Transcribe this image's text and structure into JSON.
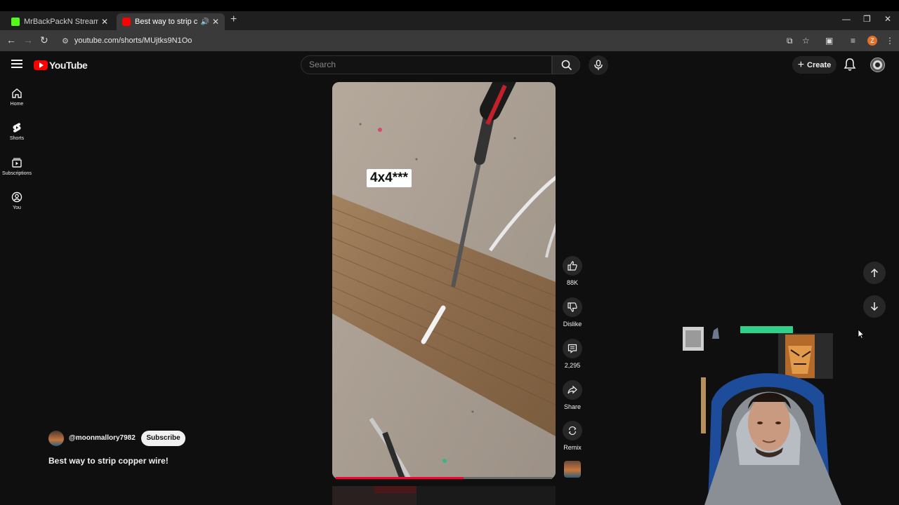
{
  "browser": {
    "tabs": [
      {
        "label": "MrBackPackN Stream - Watch Live",
        "favicon_color": "#53fc18"
      },
      {
        "label": "Best way to strip copper wire!",
        "favicon_color": "#ff0000"
      }
    ],
    "url": "youtube.com/shorts/MUjtks9N1Oo",
    "profile_initial": "Z"
  },
  "header": {
    "logo_text": "YouTube",
    "search_placeholder": "Search",
    "create_label": "Create"
  },
  "sidebar": {
    "items": [
      {
        "label": "Home",
        "icon": "home-icon"
      },
      {
        "label": "Shorts",
        "icon": "shorts-icon"
      },
      {
        "label": "Subscriptions",
        "icon": "subscriptions-icon"
      },
      {
        "label": "You",
        "icon": "you-icon"
      }
    ]
  },
  "video": {
    "overlay_text": "4x4***",
    "progress": 0.59
  },
  "actions": {
    "like_count": "88K",
    "dislike_label": "Dislike",
    "comment_count": "2,295",
    "share_label": "Share",
    "remix_label": "Remix"
  },
  "channel": {
    "handle": "@moonmallory7982",
    "subscribe_label": "Subscribe",
    "title": "Best way to strip copper wire!"
  },
  "colors": {
    "accent": "#ff0000",
    "background": "#0f0f0f",
    "progress": "#ff0033"
  }
}
